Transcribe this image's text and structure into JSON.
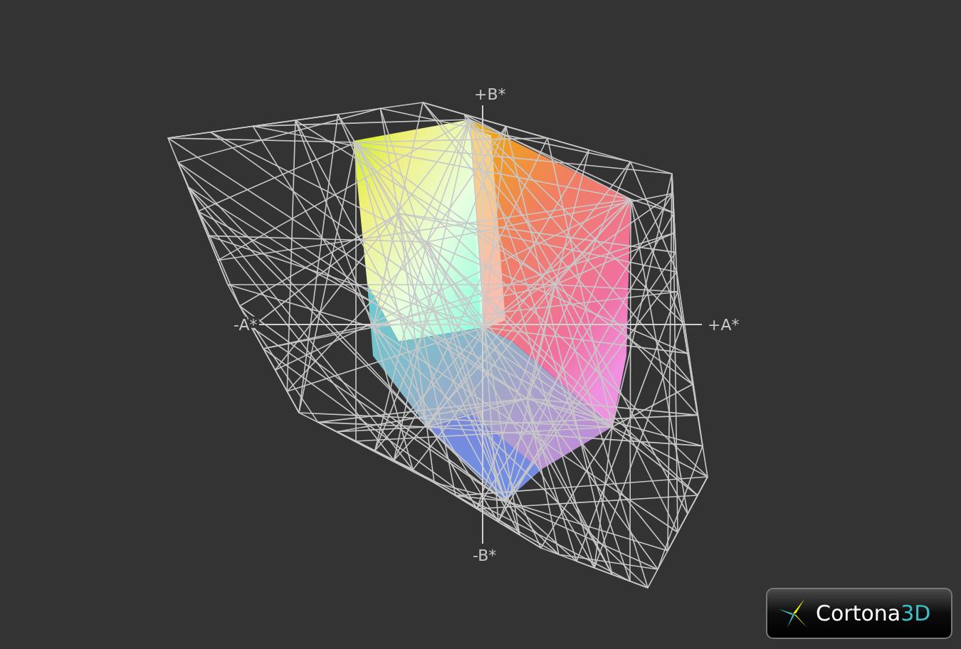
{
  "viewer": {
    "axis_labels": [
      {
        "kind": "plus_b",
        "text": "+B*"
      },
      {
        "kind": "plus_a",
        "text": "+A*"
      },
      {
        "kind": "minus_a",
        "text": "-A*"
      },
      {
        "kind": "minus_b",
        "text": "-B*"
      }
    ],
    "logo": {
      "name": "Cortona",
      "suffix": "3D"
    }
  }
}
